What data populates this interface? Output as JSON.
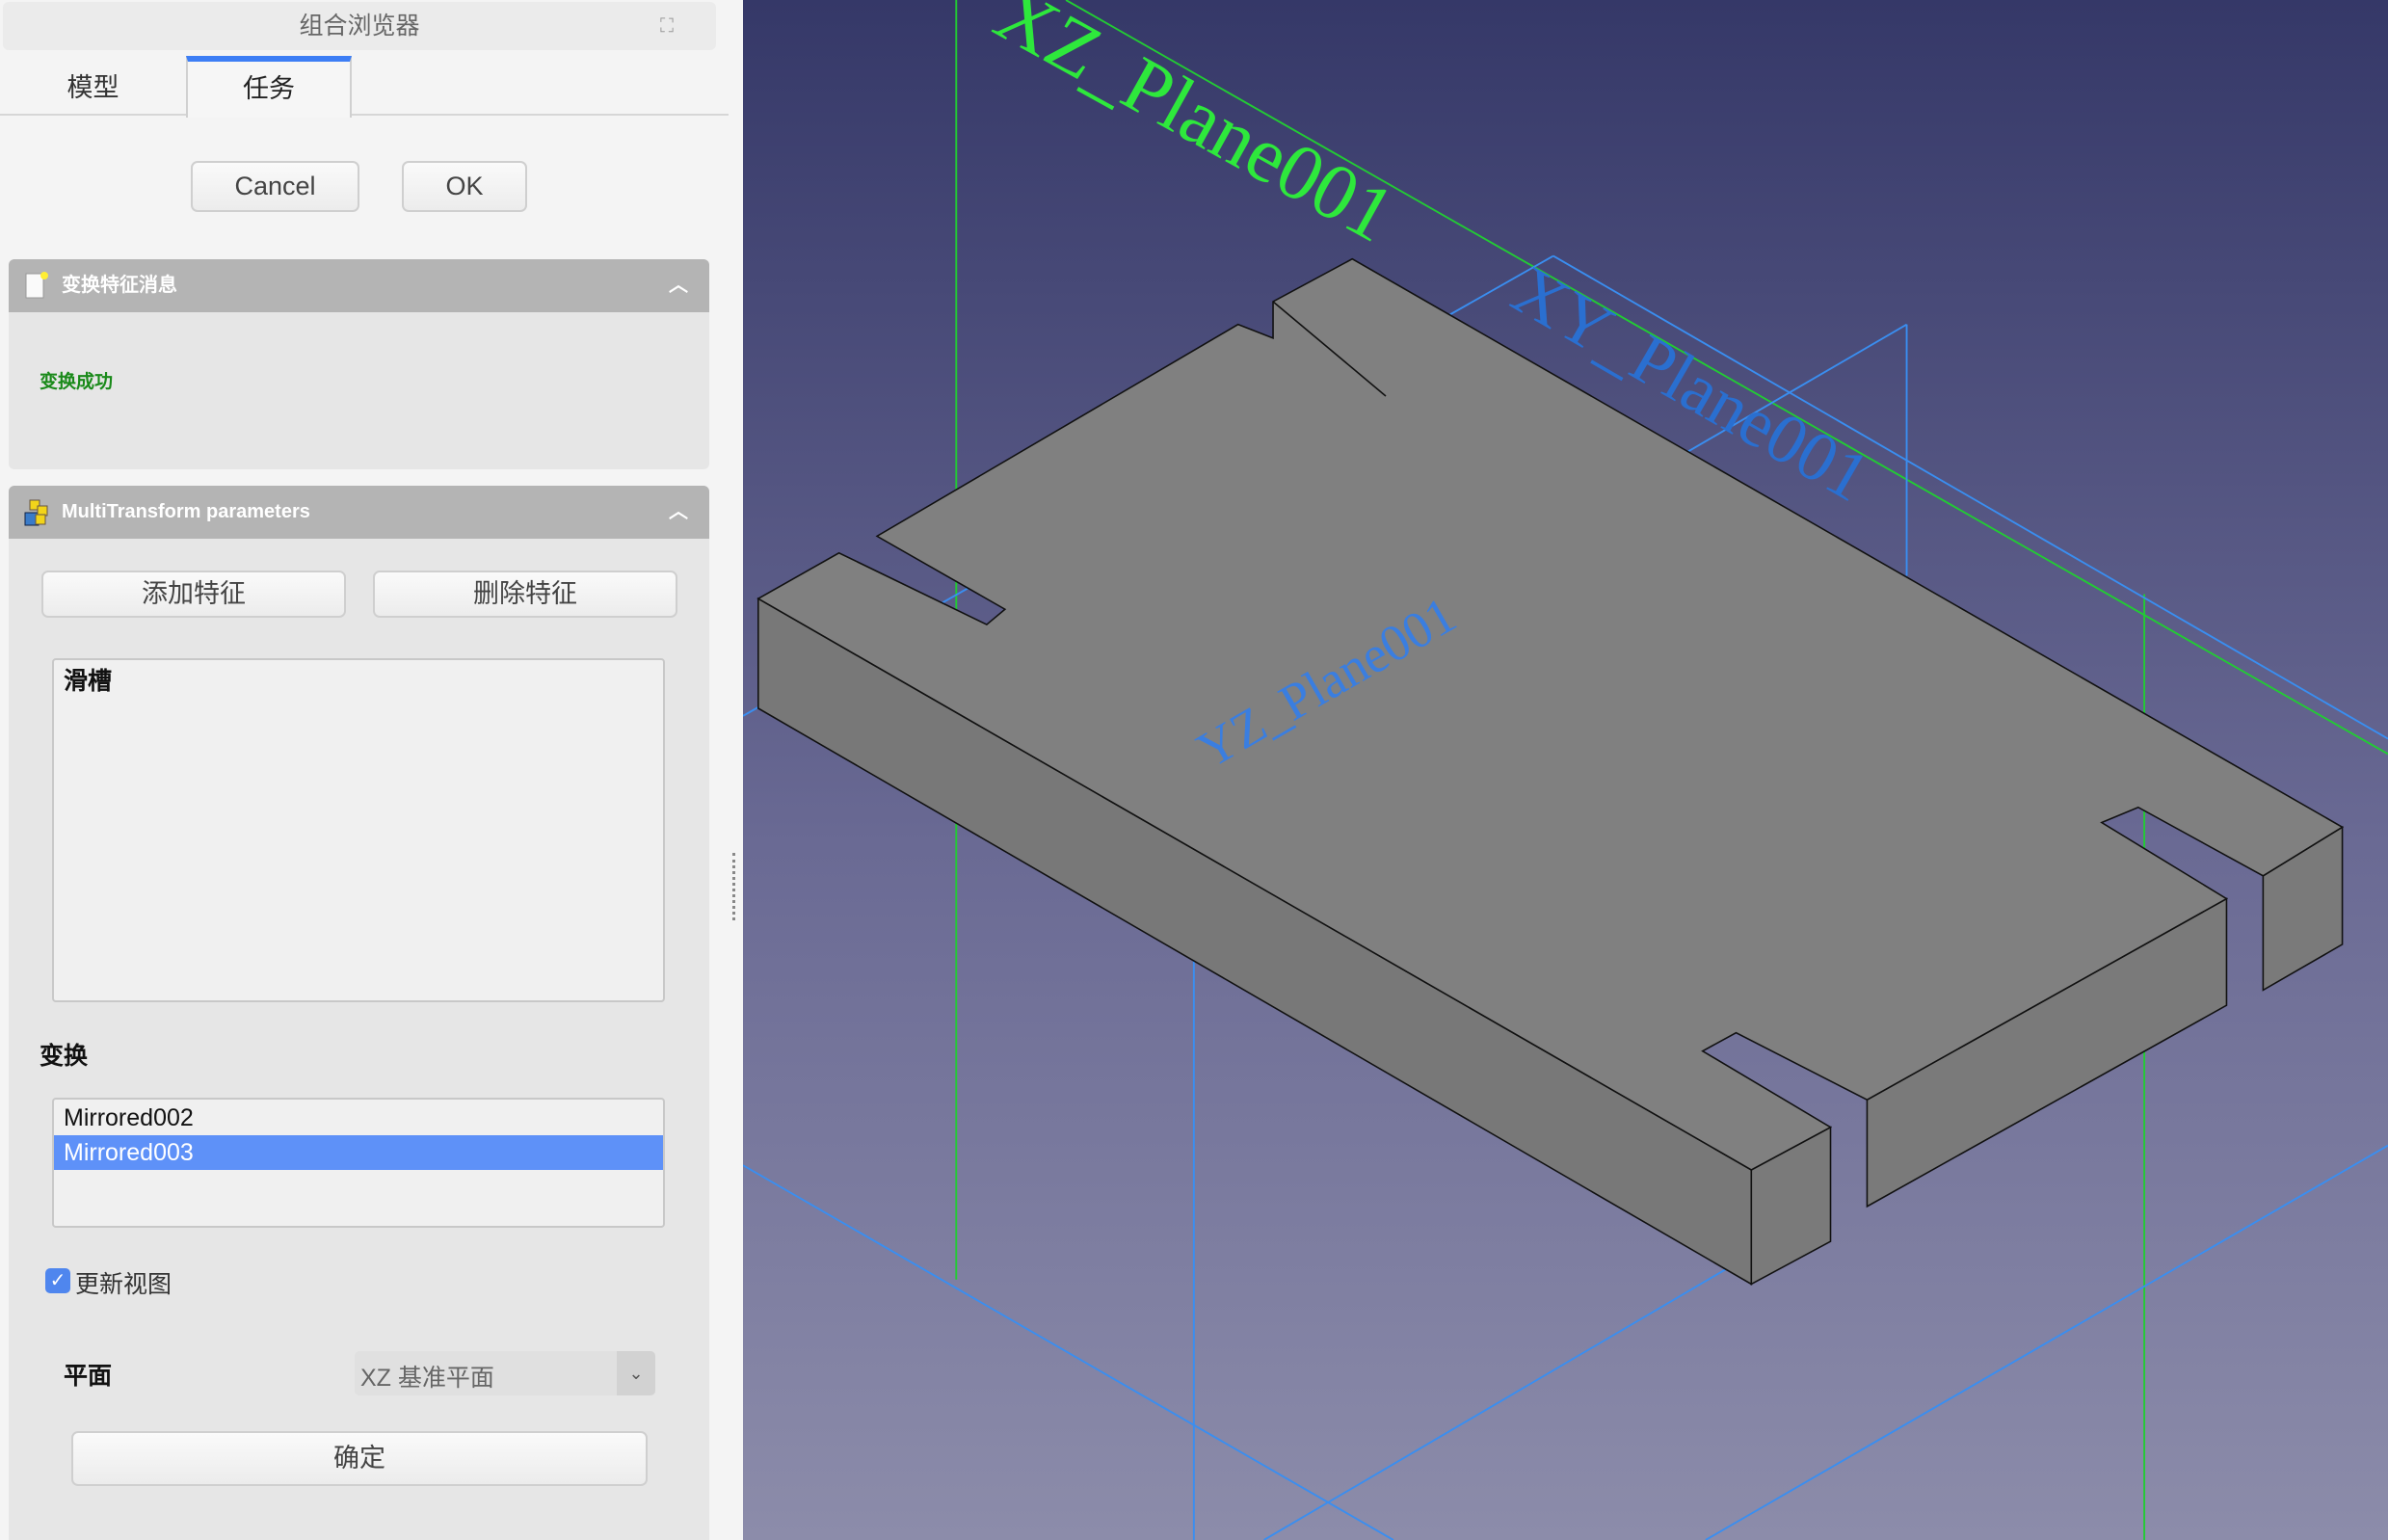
{
  "panel_title": "组合浏览器",
  "tabs": [
    {
      "label": "模型"
    },
    {
      "label": "任务"
    }
  ],
  "actions": {
    "cancel": "Cancel",
    "ok": "OK"
  },
  "message_panel": {
    "title": "变换特征消息",
    "message": "变换成功",
    "message_color": "#1a8a1a"
  },
  "params_panel": {
    "title": "MultiTransform parameters",
    "add_feature": "添加特征",
    "remove_feature": "删除特征",
    "features": [
      "滑槽"
    ],
    "transforms_label": "变换",
    "transforms": [
      "Mirrored002",
      "Mirrored003"
    ],
    "selected_transform": "Mirrored003",
    "update_view_label": "更新视图",
    "update_view_checked": true,
    "plane_label": "平面",
    "plane_value": "XZ 基准平面",
    "confirm": "确定"
  },
  "viewport": {
    "labels": {
      "xz": "XZ_Plane001",
      "xy": "XY_Plane001",
      "yz": "YZ_Plane001"
    },
    "accent": "#3d7ef5"
  }
}
